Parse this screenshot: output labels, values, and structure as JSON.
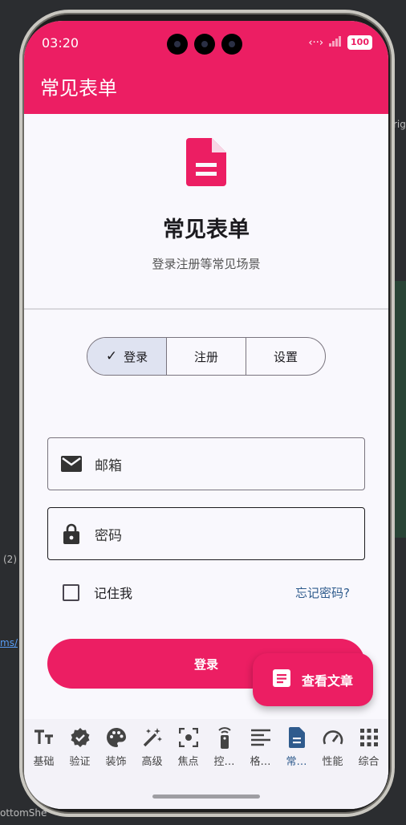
{
  "background": {
    "left_label": "(2)",
    "left_link": "ms/",
    "bottom_text": "ottomShe",
    "right_text": "rig"
  },
  "status_bar": {
    "time": "03:20",
    "battery": "100"
  },
  "app_bar": {
    "title": "常见表单"
  },
  "hero": {
    "title": "常见表单",
    "subtitle": "登录注册等常见场景"
  },
  "segments": [
    {
      "label": "登录",
      "selected": true
    },
    {
      "label": "注册",
      "selected": false
    },
    {
      "label": "设置",
      "selected": false
    }
  ],
  "form": {
    "email_label": "邮箱",
    "password_label": "密码",
    "remember_label": "记住我",
    "remember_checked": false,
    "forgot_label": "忘记密码?",
    "submit_label": "登录"
  },
  "fab": {
    "label": "查看文章"
  },
  "bottom_nav": [
    {
      "label": "基础",
      "icon": "text-format-icon"
    },
    {
      "label": "验证",
      "icon": "verified-icon"
    },
    {
      "label": "装饰",
      "icon": "palette-icon"
    },
    {
      "label": "高级",
      "icon": "magic-wand-icon"
    },
    {
      "label": "焦点",
      "icon": "focus-icon"
    },
    {
      "label": "控…",
      "icon": "remote-icon"
    },
    {
      "label": "格…",
      "icon": "align-left-icon"
    },
    {
      "label": "常…",
      "icon": "document-icon",
      "active": true
    },
    {
      "label": "性能",
      "icon": "speed-icon"
    },
    {
      "label": "综合",
      "icon": "apps-icon"
    }
  ],
  "colors": {
    "primary": "#ec1e63",
    "accent_text": "#2f5b8d",
    "segment_selected": "#dfe3f1"
  }
}
